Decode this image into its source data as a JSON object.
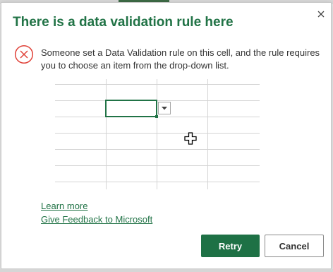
{
  "dialog": {
    "title": "There is a data validation rule here",
    "message": "Someone set a Data Validation rule on this cell, and the rule requires you to choose an item from the drop-down list.",
    "learn_more_link": "Learn more",
    "feedback_link": "Give Feedback to Microsoft",
    "retry_label": "Retry",
    "cancel_label": "Cancel",
    "close_icon": "close-icon",
    "status_icon": "error-circle-x-icon"
  },
  "colors": {
    "accent": "#217346",
    "primary_button": "#1e7145",
    "error_red": "#e0433a"
  }
}
